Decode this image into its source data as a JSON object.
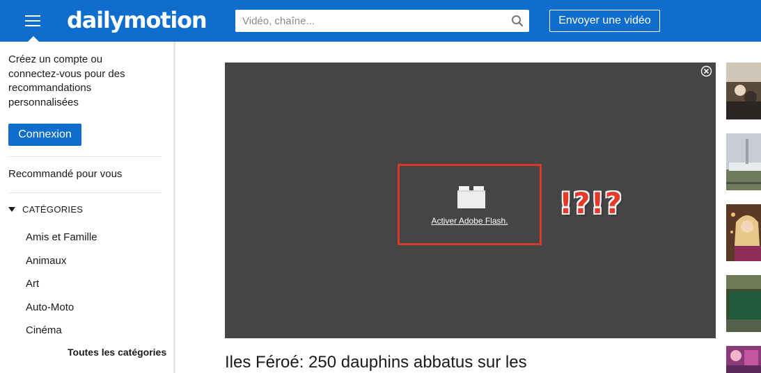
{
  "header": {
    "logo": "dailymotion",
    "search_placeholder": "Vidéo, chaîne...",
    "upload_label": "Envoyer une vidéo"
  },
  "sidebar": {
    "intro": "Créez un compte ou connectez-vous pour des recommandations personnalisées",
    "login_label": "Connexion",
    "recommended_label": "Recommandé pour vous",
    "categories_heading": "CATÉGORIES",
    "categories": [
      "Amis et Famille",
      "Animaux",
      "Art",
      "Auto-Moto",
      "Cinéma"
    ],
    "all_categories_label": "Toutes les catégories"
  },
  "player": {
    "flash_link": "Activer Adobe Flash.",
    "annotation": "!?!?"
  },
  "video": {
    "title": "Iles Féroé: 250 dauphins abbatus sur les"
  },
  "colors": {
    "brand_blue": "#0f6ecd",
    "player_bg": "#454545",
    "highlight_red": "#d9392b"
  },
  "icons": {
    "menu": "hamburger-icon",
    "search": "search-icon",
    "close": "close-icon",
    "plugin": "lego-plugin-icon"
  }
}
